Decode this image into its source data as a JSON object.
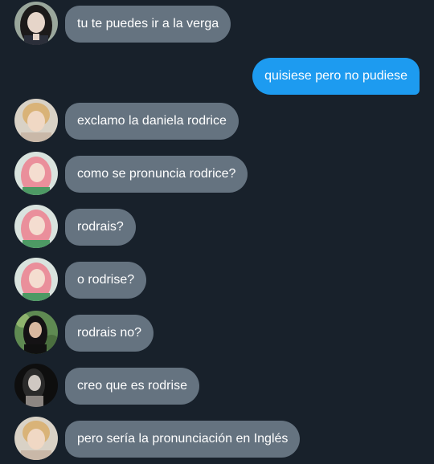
{
  "colors": {
    "background": "#18212b",
    "incoming_bubble": "#657380",
    "outgoing_bubble": "#1d9bf0",
    "text": "#ffffff"
  },
  "messages": [
    {
      "direction": "incoming",
      "avatar": "avatar-dark-hair-girl",
      "text": "tu te puedes ir a la verga"
    },
    {
      "direction": "outgoing",
      "text": "quisiese pero no pudiese"
    },
    {
      "direction": "incoming",
      "avatar": "avatar-blonde-short-hair",
      "text": "exclamo la daniela rodrice"
    },
    {
      "direction": "incoming",
      "avatar": "avatar-pink-hair-girl",
      "text": "como se pronuncia rodrice?"
    },
    {
      "direction": "incoming",
      "avatar": "avatar-pink-hair-girl",
      "text": "rodrais?"
    },
    {
      "direction": "incoming",
      "avatar": "avatar-pink-hair-girl",
      "text": "o rodrise?"
    },
    {
      "direction": "incoming",
      "avatar": "avatar-dark-hair-outdoor",
      "text": "rodrais no?"
    },
    {
      "direction": "incoming",
      "avatar": "avatar-dark-bw-photo",
      "text": "creo que es rodrise"
    },
    {
      "direction": "incoming",
      "avatar": "avatar-blonde-short-hair",
      "text": "pero sería la pronunciación en Inglés"
    }
  ]
}
